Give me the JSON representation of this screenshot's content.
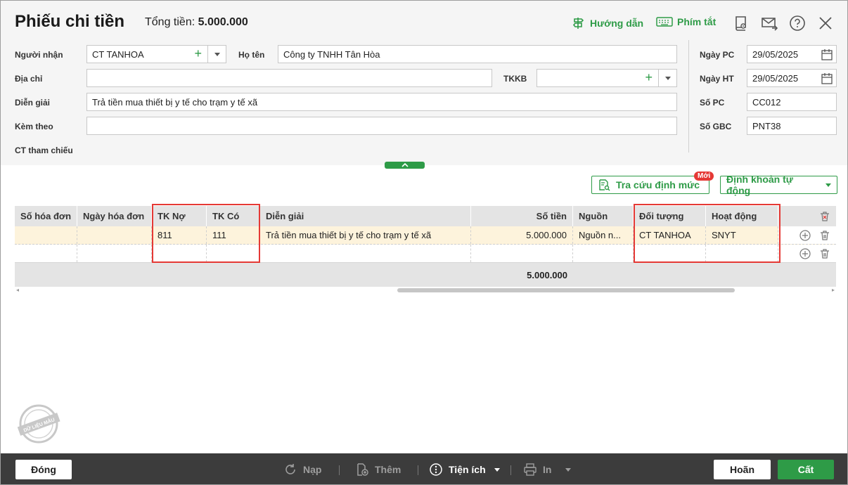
{
  "title": "Phiếu chi tiền",
  "total_label": "Tổng tiền:",
  "total_value": "5.000.000",
  "header_links": {
    "guide": "Hướng dẫn",
    "shortcuts": "Phím tắt"
  },
  "form": {
    "recipient_label": "Người nhận",
    "recipient_value": "CT TANHOA",
    "fullname_label": "Họ tên",
    "fullname_value": "Công ty TNHH Tân Hòa",
    "address_label": "Địa chỉ",
    "address_value": "",
    "tkkb_label": "TKKB",
    "tkkb_value": "",
    "description_label": "Diễn giải",
    "description_value": "Trả tiền mua thiết bị y tế cho trạm y tế xã",
    "attach_label": "Kèm theo",
    "attach_value": "",
    "reference_label": "CT tham chiếu",
    "pc_date_label": "Ngày PC",
    "pc_date_value": "29/05/2025",
    "ht_date_label": "Ngày HT",
    "ht_date_value": "29/05/2025",
    "pc_no_label": "Số PC",
    "pc_no_value": "CC012",
    "gbc_no_label": "Số GBC",
    "gbc_no_value": "PNT38"
  },
  "actions": {
    "lookup": "Tra cứu định mức",
    "new_badge": "Mới",
    "auto_account": "Định khoản tự động"
  },
  "table": {
    "headers": [
      "Số hóa đơn",
      "Ngày hóa đơn",
      "TK Nợ",
      "TK Có",
      "Diễn giải",
      "Số tiền",
      "Nguồn",
      "Đối tượng",
      "Hoạt động"
    ],
    "rows": [
      [
        "",
        "",
        "811",
        "111",
        "Trả tiền mua thiết bị y tế cho trạm y tế xã",
        "5.000.000",
        "Nguồn n...",
        "CT TANHOA",
        "SNYT"
      ],
      [
        "",
        "",
        "",
        "",
        "",
        "",
        "",
        "",
        ""
      ]
    ],
    "sum_amount": "5.000.000"
  },
  "stamp_text": "DỮ LIỆU MẪU",
  "footer": {
    "close": "Đóng",
    "reload": "Nạp",
    "add": "Thêm",
    "utilities": "Tiện ích",
    "print": "In",
    "cancel": "Hoãn",
    "save": "Cất"
  },
  "colors": {
    "accent": "#2e9b47",
    "highlight_box": "#e53935",
    "footer_bg": "#3c3c3c",
    "row_selected": "#fdf3dc"
  }
}
